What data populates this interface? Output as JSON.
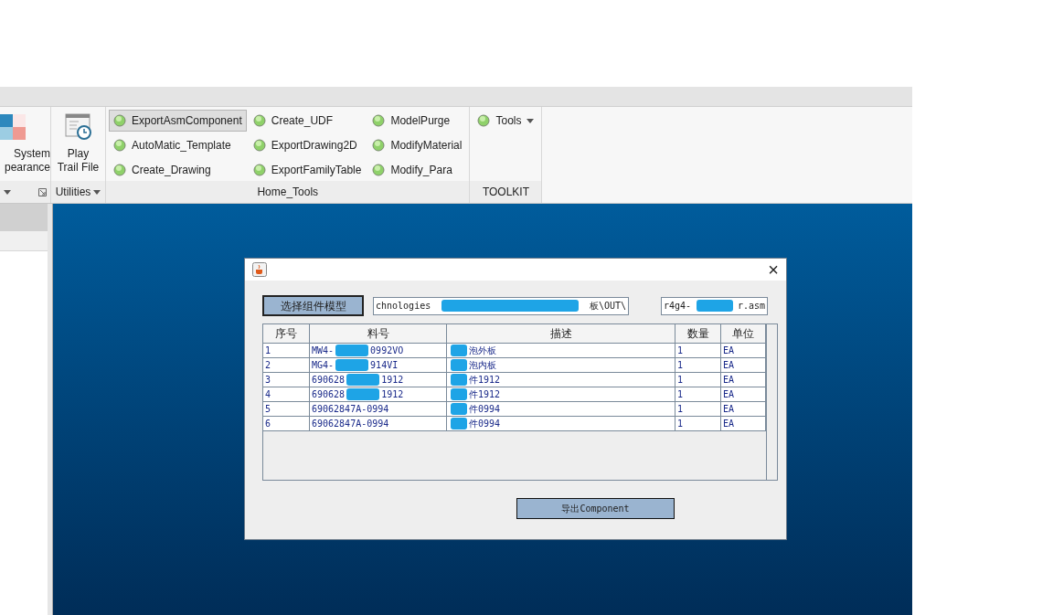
{
  "ribbon": {
    "groups": [
      {
        "kind": "partial",
        "label_lines": [
          "System",
          "pearance"
        ]
      },
      {
        "kind": "single",
        "label_lines": [
          "Play",
          "Trail File"
        ],
        "footer": "Utilities"
      },
      {
        "kind": "list",
        "footer": "Home_Tools",
        "columns": [
          [
            {
              "label": "ExportAsmComponent",
              "selected": true
            },
            {
              "label": "AutoMatic_Template",
              "selected": false
            },
            {
              "label": "Create_Drawing",
              "selected": false
            }
          ],
          [
            {
              "label": "Create_UDF",
              "selected": false
            },
            {
              "label": "ExportDrawing2D",
              "selected": false
            },
            {
              "label": "ExportFamilyTable",
              "selected": false
            }
          ],
          [
            {
              "label": "ModelPurge",
              "selected": false
            },
            {
              "label": "ModifyMaterial",
              "selected": false
            },
            {
              "label": "Modify_Para",
              "selected": false
            }
          ]
        ]
      },
      {
        "kind": "list",
        "footer": "TOOLKIT",
        "columns": [
          [
            {
              "label": "Tools",
              "selected": false,
              "dropdown": true
            }
          ]
        ]
      }
    ]
  },
  "dialog": {
    "close": "×",
    "select_button": "选择组件模型",
    "path_field": {
      "parts": [
        "chnologies",
        "板\\OUT\\"
      ],
      "masked_gap": true
    },
    "file_field": {
      "parts": [
        "r4g4-",
        "r.asm"
      ],
      "masked_gap": true
    },
    "table": {
      "columns": [
        "序号",
        "料号",
        "描述",
        "数量",
        "单位"
      ],
      "rows": [
        [
          {
            "parts": [
              "1"
            ]
          },
          {
            "parts": [
              "MW4-",
              "0992VO"
            ],
            "masked_gap": true
          },
          {
            "parts": [
              "泡外板"
            ],
            "masked_lead": true
          },
          {
            "parts": [
              "1"
            ]
          },
          {
            "parts": [
              "EA"
            ]
          }
        ],
        [
          {
            "parts": [
              "2"
            ]
          },
          {
            "parts": [
              "MG4-",
              "914VI"
            ],
            "masked_gap": true
          },
          {
            "parts": [
              "泡内板"
            ],
            "masked_lead": true
          },
          {
            "parts": [
              "1"
            ]
          },
          {
            "parts": [
              "EA"
            ]
          }
        ],
        [
          {
            "parts": [
              "3"
            ]
          },
          {
            "parts": [
              "690628",
              "1912"
            ],
            "masked_gap": true
          },
          {
            "parts": [
              "件1912"
            ],
            "masked_lead": true
          },
          {
            "parts": [
              "1"
            ]
          },
          {
            "parts": [
              "EA"
            ]
          }
        ],
        [
          {
            "parts": [
              "4"
            ]
          },
          {
            "parts": [
              "690628",
              "1912"
            ],
            "masked_gap": true
          },
          {
            "parts": [
              "件1912"
            ],
            "masked_lead": true
          },
          {
            "parts": [
              "1"
            ]
          },
          {
            "parts": [
              "EA"
            ]
          }
        ],
        [
          {
            "parts": [
              "5"
            ]
          },
          {
            "parts": [
              "69062847A-0994"
            ]
          },
          {
            "parts": [
              "件0994"
            ],
            "masked_lead": true
          },
          {
            "parts": [
              "1"
            ]
          },
          {
            "parts": [
              "EA"
            ]
          }
        ],
        [
          {
            "parts": [
              "6"
            ]
          },
          {
            "parts": [
              "69062847A-0994"
            ]
          },
          {
            "parts": [
              "件0994"
            ],
            "masked_lead": true
          },
          {
            "parts": [
              "1"
            ]
          },
          {
            "parts": [
              "EA"
            ]
          }
        ]
      ]
    },
    "export_button": "导出Component"
  }
}
